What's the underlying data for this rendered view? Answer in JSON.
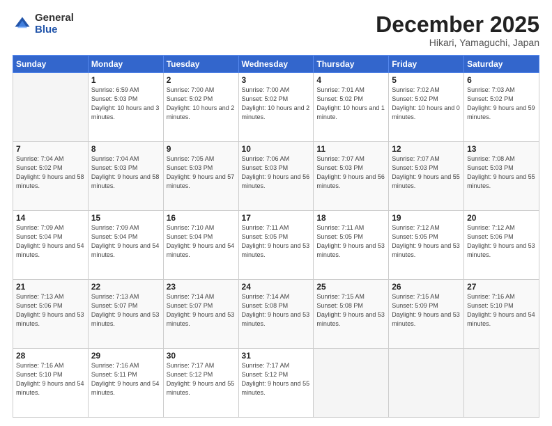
{
  "header": {
    "logo_general": "General",
    "logo_blue": "Blue",
    "title": "December 2025",
    "location": "Hikari, Yamaguchi, Japan"
  },
  "calendar": {
    "days_of_week": [
      "Sunday",
      "Monday",
      "Tuesday",
      "Wednesday",
      "Thursday",
      "Friday",
      "Saturday"
    ],
    "weeks": [
      [
        {
          "day": "",
          "info": ""
        },
        {
          "day": "1",
          "info": "Sunrise: 6:59 AM\nSunset: 5:03 PM\nDaylight: 10 hours\nand 3 minutes."
        },
        {
          "day": "2",
          "info": "Sunrise: 7:00 AM\nSunset: 5:02 PM\nDaylight: 10 hours\nand 2 minutes."
        },
        {
          "day": "3",
          "info": "Sunrise: 7:00 AM\nSunset: 5:02 PM\nDaylight: 10 hours\nand 2 minutes."
        },
        {
          "day": "4",
          "info": "Sunrise: 7:01 AM\nSunset: 5:02 PM\nDaylight: 10 hours\nand 1 minute."
        },
        {
          "day": "5",
          "info": "Sunrise: 7:02 AM\nSunset: 5:02 PM\nDaylight: 10 hours\nand 0 minutes."
        },
        {
          "day": "6",
          "info": "Sunrise: 7:03 AM\nSunset: 5:02 PM\nDaylight: 9 hours\nand 59 minutes."
        }
      ],
      [
        {
          "day": "7",
          "info": "Sunrise: 7:04 AM\nSunset: 5:02 PM\nDaylight: 9 hours\nand 58 minutes."
        },
        {
          "day": "8",
          "info": "Sunrise: 7:04 AM\nSunset: 5:03 PM\nDaylight: 9 hours\nand 58 minutes."
        },
        {
          "day": "9",
          "info": "Sunrise: 7:05 AM\nSunset: 5:03 PM\nDaylight: 9 hours\nand 57 minutes."
        },
        {
          "day": "10",
          "info": "Sunrise: 7:06 AM\nSunset: 5:03 PM\nDaylight: 9 hours\nand 56 minutes."
        },
        {
          "day": "11",
          "info": "Sunrise: 7:07 AM\nSunset: 5:03 PM\nDaylight: 9 hours\nand 56 minutes."
        },
        {
          "day": "12",
          "info": "Sunrise: 7:07 AM\nSunset: 5:03 PM\nDaylight: 9 hours\nand 55 minutes."
        },
        {
          "day": "13",
          "info": "Sunrise: 7:08 AM\nSunset: 5:03 PM\nDaylight: 9 hours\nand 55 minutes."
        }
      ],
      [
        {
          "day": "14",
          "info": "Sunrise: 7:09 AM\nSunset: 5:04 PM\nDaylight: 9 hours\nand 54 minutes."
        },
        {
          "day": "15",
          "info": "Sunrise: 7:09 AM\nSunset: 5:04 PM\nDaylight: 9 hours\nand 54 minutes."
        },
        {
          "day": "16",
          "info": "Sunrise: 7:10 AM\nSunset: 5:04 PM\nDaylight: 9 hours\nand 54 minutes."
        },
        {
          "day": "17",
          "info": "Sunrise: 7:11 AM\nSunset: 5:05 PM\nDaylight: 9 hours\nand 53 minutes."
        },
        {
          "day": "18",
          "info": "Sunrise: 7:11 AM\nSunset: 5:05 PM\nDaylight: 9 hours\nand 53 minutes."
        },
        {
          "day": "19",
          "info": "Sunrise: 7:12 AM\nSunset: 5:05 PM\nDaylight: 9 hours\nand 53 minutes."
        },
        {
          "day": "20",
          "info": "Sunrise: 7:12 AM\nSunset: 5:06 PM\nDaylight: 9 hours\nand 53 minutes."
        }
      ],
      [
        {
          "day": "21",
          "info": "Sunrise: 7:13 AM\nSunset: 5:06 PM\nDaylight: 9 hours\nand 53 minutes."
        },
        {
          "day": "22",
          "info": "Sunrise: 7:13 AM\nSunset: 5:07 PM\nDaylight: 9 hours\nand 53 minutes."
        },
        {
          "day": "23",
          "info": "Sunrise: 7:14 AM\nSunset: 5:07 PM\nDaylight: 9 hours\nand 53 minutes."
        },
        {
          "day": "24",
          "info": "Sunrise: 7:14 AM\nSunset: 5:08 PM\nDaylight: 9 hours\nand 53 minutes."
        },
        {
          "day": "25",
          "info": "Sunrise: 7:15 AM\nSunset: 5:08 PM\nDaylight: 9 hours\nand 53 minutes."
        },
        {
          "day": "26",
          "info": "Sunrise: 7:15 AM\nSunset: 5:09 PM\nDaylight: 9 hours\nand 53 minutes."
        },
        {
          "day": "27",
          "info": "Sunrise: 7:16 AM\nSunset: 5:10 PM\nDaylight: 9 hours\nand 54 minutes."
        }
      ],
      [
        {
          "day": "28",
          "info": "Sunrise: 7:16 AM\nSunset: 5:10 PM\nDaylight: 9 hours\nand 54 minutes."
        },
        {
          "day": "29",
          "info": "Sunrise: 7:16 AM\nSunset: 5:11 PM\nDaylight: 9 hours\nand 54 minutes."
        },
        {
          "day": "30",
          "info": "Sunrise: 7:17 AM\nSunset: 5:12 PM\nDaylight: 9 hours\nand 55 minutes."
        },
        {
          "day": "31",
          "info": "Sunrise: 7:17 AM\nSunset: 5:12 PM\nDaylight: 9 hours\nand 55 minutes."
        },
        {
          "day": "",
          "info": ""
        },
        {
          "day": "",
          "info": ""
        },
        {
          "day": "",
          "info": ""
        }
      ]
    ]
  }
}
